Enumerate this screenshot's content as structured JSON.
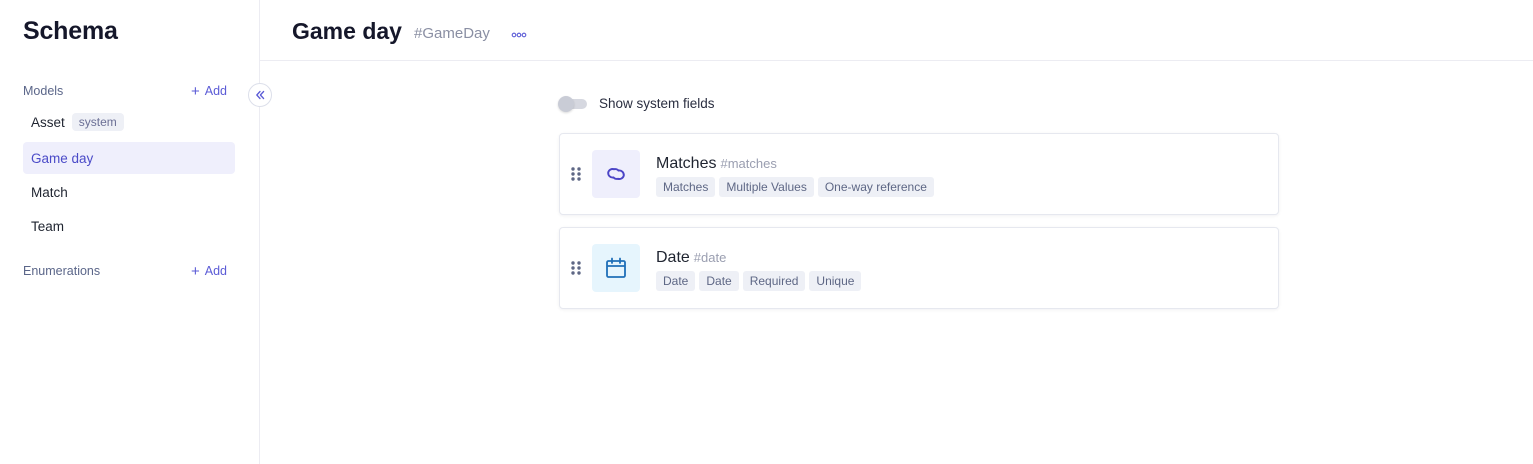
{
  "sidebar": {
    "title": "Schema",
    "models_label": "Models",
    "enumerations_label": "Enumerations",
    "add_label": "Add",
    "system_badge": "system",
    "models": [
      {
        "label": "Asset"
      },
      {
        "label": "Game day"
      },
      {
        "label": "Match"
      },
      {
        "label": "Team"
      }
    ],
    "active_model": "Game day"
  },
  "header": {
    "title": "Game day",
    "api_id": "#GameDay"
  },
  "main": {
    "toggle_label": "Show system fields",
    "toggle_on": false,
    "fields": [
      {
        "name": "Matches",
        "api_id": "#matches",
        "icon": "link-icon",
        "tags": [
          "Matches",
          "Multiple Values",
          "One-way reference"
        ]
      },
      {
        "name": "Date",
        "api_id": "#date",
        "icon": "calendar-icon",
        "tags": [
          "Date",
          "Date",
          "Required",
          "Unique"
        ]
      }
    ]
  },
  "colors": {
    "accent": "#5b5bd6",
    "active_bg": "#efeffc",
    "date_icon": "#1f6fb8",
    "date_icon_bg": "#e6f5fd"
  }
}
